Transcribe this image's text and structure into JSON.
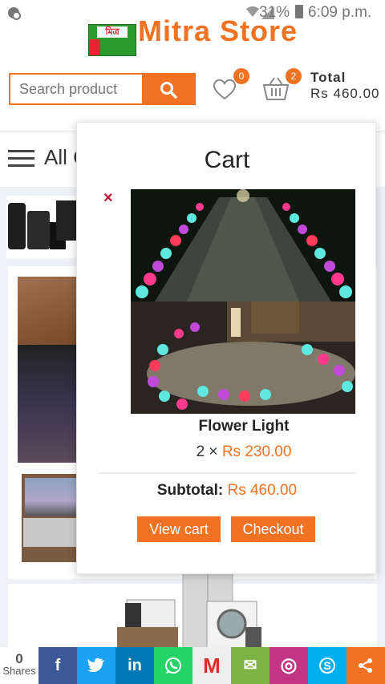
{
  "status_bar": {
    "battery_pct": "31%",
    "time": "6:09 p.m."
  },
  "header": {
    "store_name": "Mitra Store",
    "logo_sign": "মিত্র",
    "search_placeholder": "Search product",
    "wishlist_count": "0",
    "cart_count": "2",
    "total_label": "Total",
    "total_value": "Rs 460.00"
  },
  "menu": {
    "all_categories": "All C"
  },
  "cart": {
    "title": "Cart",
    "remove_symbol": "×",
    "item": {
      "name": "Flower Light",
      "quantity": "2",
      "multiply": "×",
      "price": "Rs 230.00"
    },
    "subtotal_label": "Subtotal:",
    "subtotal_value": "Rs 460.00",
    "view_cart_label": "View cart",
    "checkout_label": "Checkout"
  },
  "share_bar": {
    "count": "0",
    "count_label": "Shares",
    "items": [
      {
        "name": "facebook",
        "glyph": "f",
        "color": "#3b5998"
      },
      {
        "name": "twitter",
        "glyph": "t",
        "color": "#1da1f2"
      },
      {
        "name": "linkedin",
        "glyph": "in",
        "color": "#0077b5"
      },
      {
        "name": "whatsapp",
        "glyph": "w",
        "color": "#25d366"
      },
      {
        "name": "gmail",
        "glyph": "M",
        "color": "#eeeeee"
      },
      {
        "name": "email",
        "glyph": "✉",
        "color": "#7cb342"
      },
      {
        "name": "instagram",
        "glyph": "◎",
        "color": "#c13584"
      },
      {
        "name": "skype",
        "glyph": "S",
        "color": "#00aff0"
      },
      {
        "name": "share",
        "glyph": "<",
        "color": "#f07222"
      }
    ]
  },
  "colors": {
    "accent": "#f07222",
    "remove": "#c8102e"
  }
}
